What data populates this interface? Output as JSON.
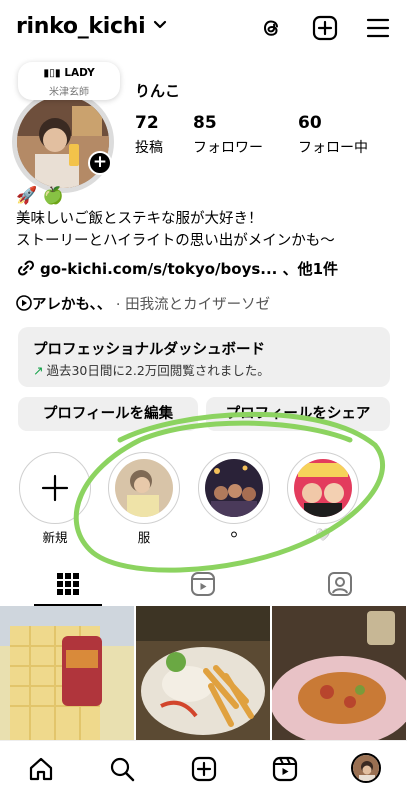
{
  "header": {
    "username": "rinko_kichi",
    "icons": [
      "threads-icon",
      "new-post-icon",
      "menu-icon"
    ]
  },
  "note": {
    "title": "LADY",
    "subtitle": "米津玄師"
  },
  "profile": {
    "display_name": "りんこ",
    "stats": [
      {
        "value": "72",
        "label": "投稿"
      },
      {
        "value": "85",
        "label": "フォロワー"
      },
      {
        "value": "60",
        "label": "フォロー中"
      }
    ],
    "bio_emoji_1": "🚀",
    "bio_emoji_2": "🍏",
    "bio_line_1": "美味しいご飯とステキな服が大好き！",
    "bio_line_2": "ストーリーとハイライトの思い出がメインかも〜",
    "link_text": "go-kichi.com/s/tokyo/boys... 、他1件",
    "music_song": "アレかも、、",
    "music_separator": " · ",
    "music_artist": "田我流とカイザーソゼ"
  },
  "dashboard": {
    "title": "プロフェッショナルダッシュボード",
    "arrow": "↗",
    "subtitle": "過去30日間に2.2万回閲覧されました。"
  },
  "buttons": {
    "edit": "プロフィールを編集",
    "share": "プロフィールをシェア"
  },
  "highlights": [
    {
      "label": "新規",
      "icon": "plus-icon"
    },
    {
      "label": "服",
      "icon": ""
    },
    {
      "label": "⚪",
      "icon": ""
    },
    {
      "label": "🤍",
      "icon": ""
    }
  ],
  "tabs": [
    "grid-icon",
    "reels-icon",
    "tagged-icon"
  ],
  "bottom_nav": [
    "home-icon",
    "search-icon",
    "create-icon",
    "reels-icon",
    "profile-avatar"
  ],
  "colors": {
    "accent_green": "#16a34a",
    "scribble": "#8cd360",
    "button_bg": "#efefef"
  }
}
